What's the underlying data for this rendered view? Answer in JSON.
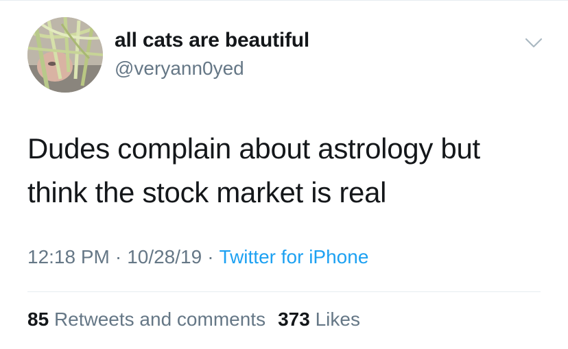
{
  "user": {
    "display_name": "all cats are beautiful",
    "handle": "@veryann0yed"
  },
  "tweet": {
    "text_line_1": "Dudes complain about astrology but",
    "text_line_2": "think the stock market is real"
  },
  "meta": {
    "time": "12:18 PM",
    "separator": "·",
    "date": "10/28/19",
    "source": "Twitter for iPhone"
  },
  "stats": {
    "retweets_count": "85",
    "retweets_label": "Retweets and comments",
    "likes_count": "373",
    "likes_label": "Likes"
  },
  "icons": {
    "menu": "chevron-down-icon"
  },
  "colors": {
    "text": "#14171a",
    "secondary": "#657786",
    "link": "#1da1f2",
    "divider": "#e6ecf0"
  }
}
